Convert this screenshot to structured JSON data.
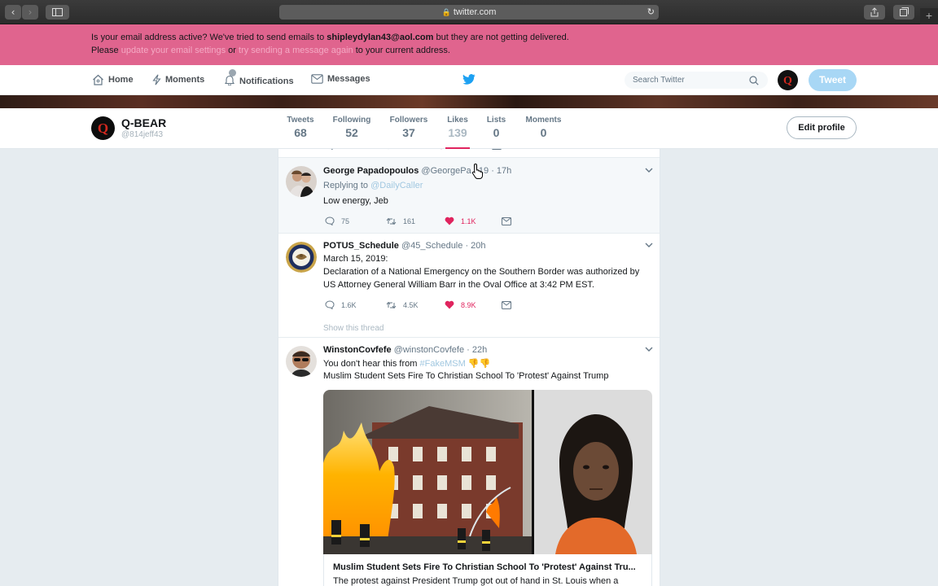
{
  "browser": {
    "url": "twitter.com"
  },
  "banner": {
    "line1_pre": "Is your email address active? We've tried to send emails to ",
    "email": "shipleydylan43@aol.com",
    "line1_post": " but they are not getting delivered.",
    "line2_pre": "Please ",
    "link1": "update your email settings",
    "line2_mid": " or ",
    "link2": "try sending a message again",
    "line2_post": " to your current address."
  },
  "nav": {
    "home": "Home",
    "moments": "Moments",
    "notifications": "Notifications",
    "messages": "Messages",
    "search_placeholder": "Search Twitter",
    "tweet_button": "Tweet"
  },
  "profile": {
    "name": "Q-BEAR",
    "handle": "@814jeff43",
    "stats": [
      {
        "label": "Tweets",
        "value": "68"
      },
      {
        "label": "Following",
        "value": "52"
      },
      {
        "label": "Followers",
        "value": "37"
      },
      {
        "label": "Likes",
        "value": "139"
      },
      {
        "label": "Lists",
        "value": "0"
      },
      {
        "label": "Moments",
        "value": "0"
      }
    ],
    "edit_button": "Edit profile"
  },
  "tweets": [
    {
      "name": "George Papadopoulos",
      "handle": "@GeorgePa...19",
      "time": "· 17h",
      "replying_label": "Replying to ",
      "replying_to": "@DailyCaller",
      "text": "Low energy, Jeb",
      "replies": "75",
      "retweets": "161",
      "likes": "1.1K"
    },
    {
      "name": "POTUS_Schedule",
      "handle": "@45_Schedule",
      "time": "· 20h",
      "text1": "March 15, 2019:",
      "text2": "Declaration of a National Emergency on the Southern Border was authorized by",
      "text3": "US Attorney General William Barr in the Oval Office at 3:42 PM EST.",
      "replies": "1.6K",
      "retweets": "4.5K",
      "likes": "8.9K",
      "show_thread": "Show this thread"
    },
    {
      "name": "WinstonCovfefe",
      "handle": "@winstonCovfefe",
      "time": "· 22h",
      "text1_pre": "You don't hear this from ",
      "hashtag": "#FakeMSM",
      "emoji": "👎👎",
      "text2": "Muslim Student Sets Fire To Christian School To 'Protest' Against Trump",
      "card_title": "Muslim Student Sets Fire To Christian School To 'Protest' Against Tru...",
      "card_desc": "The protest against President Trump got out of hand in St. Louis when a"
    }
  ]
}
